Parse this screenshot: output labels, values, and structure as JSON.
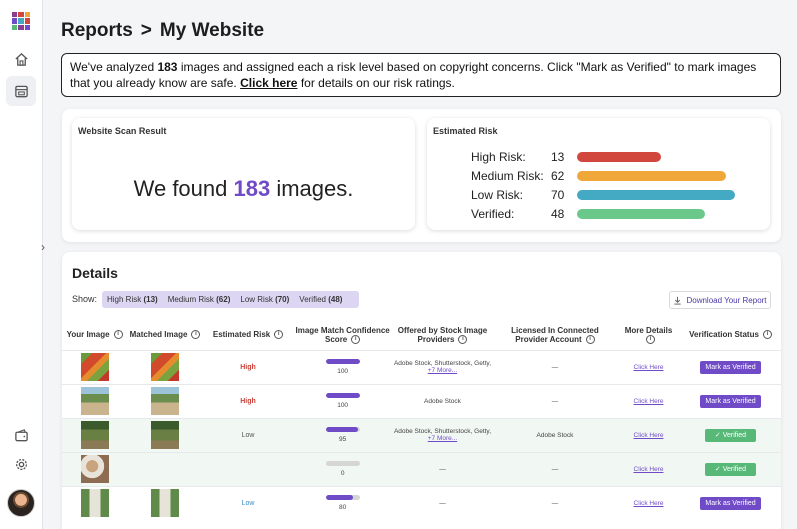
{
  "header": {
    "breadcrumb_parent": "Reports",
    "breadcrumb_separator": ">",
    "breadcrumb_current": "My Website"
  },
  "banner": {
    "text_before": "We've analyzed ",
    "count": "183",
    "text_middle": " images and assigned each a risk level based on copyright concerns. Click \"Mark as Verified\" to mark images that you already know are safe. ",
    "link_label": "Click here",
    "text_after": " for details on our risk ratings."
  },
  "scan": {
    "title": "Website Scan Result",
    "text_before": "We found ",
    "count": "183",
    "text_after": " images."
  },
  "estimated_risk": {
    "title": "Estimated Risk",
    "rows": [
      {
        "label": "High Risk:",
        "value": "13",
        "fraction": 0.53,
        "color": "#d1473d"
      },
      {
        "label": "Medium Risk:",
        "value": "62",
        "fraction": 0.94,
        "color": "#eea738"
      },
      {
        "label": "Low Risk:",
        "value": "70",
        "fraction": 1.0,
        "color": "#44a9c2"
      },
      {
        "label": "Verified:",
        "value": "48",
        "fraction": 0.81,
        "color": "#6ac98a"
      }
    ]
  },
  "details": {
    "title": "Details",
    "show_label": "Show:",
    "filters": [
      {
        "label": "High Risk",
        "count": "(13)"
      },
      {
        "label": "Medium Risk",
        "count": "(62)"
      },
      {
        "label": "Low Risk",
        "count": "(70)"
      },
      {
        "label": "Verified",
        "count": "(48)"
      }
    ],
    "download_label": "Download Your Report",
    "columns": [
      "Your Image",
      "Matched Image",
      "Estimated Risk",
      "Image Match Confidence Score",
      "Offered by Stock Image Providers",
      "Licensed In Connected Provider Account",
      "More Details",
      "Verification Status"
    ],
    "rows": [
      {
        "risk": "High",
        "score": "100",
        "score_fraction": 1.0,
        "offered": "Adobe Stock, Shutterstock, Getty,",
        "offered_more": "+7 More...",
        "licensed": "—",
        "details": "Click Here",
        "status": "Mark as Verified"
      },
      {
        "risk": "High",
        "score": "100",
        "score_fraction": 1.0,
        "offered": "Adobe Stock",
        "offered_more": "",
        "licensed": "—",
        "details": "Click Here",
        "status": "Mark as Verified"
      },
      {
        "risk": "Low",
        "score": "95",
        "score_fraction": 0.95,
        "offered": "Adobe Stock, Shutterstock, Getty,",
        "offered_more": "+7 More...",
        "licensed": "Adobe Stock",
        "details": "Click Here",
        "status": "✓ Verified"
      },
      {
        "risk": "",
        "score": "0",
        "score_fraction": 0.0,
        "offered": "—",
        "offered_more": "",
        "licensed": "—",
        "details": "Click Here",
        "status": "✓ Verified"
      },
      {
        "risk": "Low",
        "score": "80",
        "score_fraction": 0.8,
        "offered": "—",
        "offered_more": "",
        "licensed": "—",
        "details": "Click Here",
        "status": "Mark as Verified"
      }
    ]
  },
  "icons": {
    "logo": "grid-logo-icon",
    "home": "home-icon",
    "reports": "reports-icon",
    "expand": "chevron-right-icon",
    "wallet": "wallet-icon",
    "settings": "gear-icon",
    "info": "info-icon",
    "download": "download-icon"
  },
  "colors": {
    "accent": "#6f4bc7",
    "verified": "#58b878",
    "high": "#c8433a"
  }
}
